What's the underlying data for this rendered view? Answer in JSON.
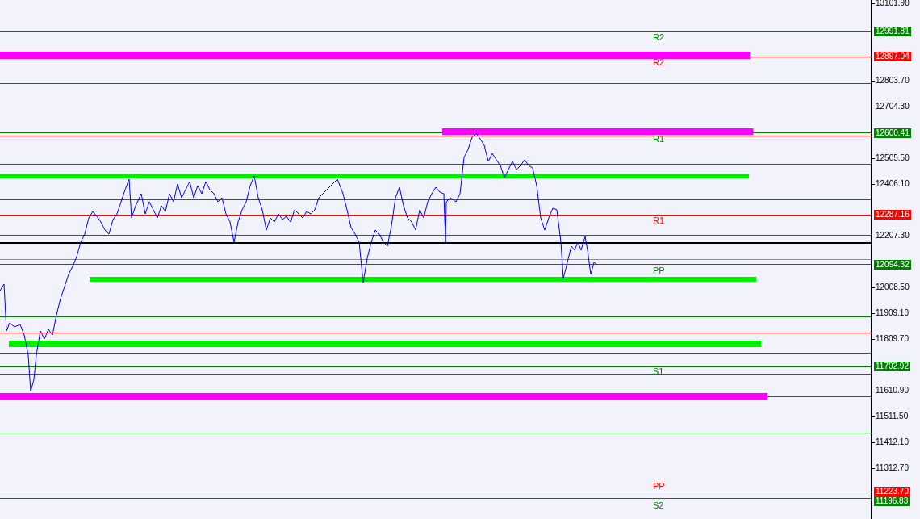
{
  "price_axis": {
    "ticks": [
      "13101.90",
      "12803.70",
      "12704.30",
      "12505.50",
      "12406.10",
      "12207.30",
      "12008.50",
      "11909.10",
      "11809.70",
      "11610.90",
      "11511.50",
      "11412.10",
      "11312.70"
    ]
  },
  "price_tags": [
    {
      "text": "12991.81",
      "color": "#008000"
    },
    {
      "text": "12897.04",
      "color": "#ff0000"
    },
    {
      "text": "12600.41",
      "color": "#008000"
    },
    {
      "text": "12287.16",
      "color": "#ff0000"
    },
    {
      "text": "12094.32",
      "color": "#008000"
    },
    {
      "text": "11702.92",
      "color": "#008000"
    },
    {
      "text": "11223.70",
      "color": "#ff0000"
    },
    {
      "text": "11196.83",
      "color": "#008000"
    }
  ],
  "level_labels": [
    {
      "text": "R2",
      "color": "#008000"
    },
    {
      "text": "R2",
      "color": "#ff0000"
    },
    {
      "text": "R1",
      "color": "#008000"
    },
    {
      "text": "R1",
      "color": "#ff0000"
    },
    {
      "text": "PP",
      "color": "#008000"
    },
    {
      "text": "S1",
      "color": "#008000"
    },
    {
      "text": "PP",
      "color": "#ff0000"
    },
    {
      "text": "S2",
      "color": "#008000"
    }
  ]
}
